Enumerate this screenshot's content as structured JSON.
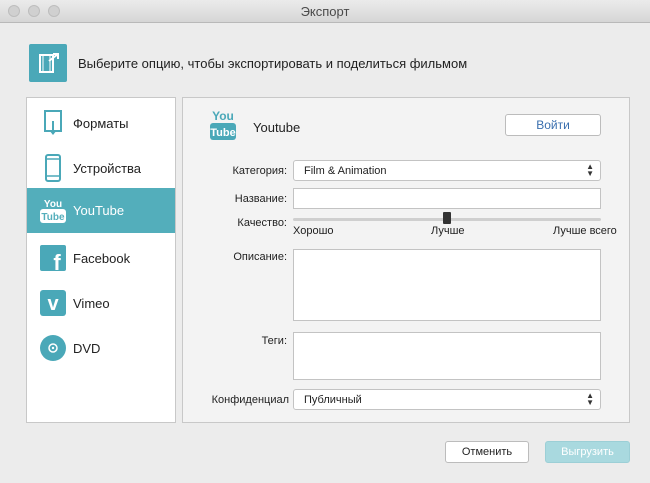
{
  "window": {
    "title": "Экспорт"
  },
  "header": {
    "text": "Выберите опцию, чтобы экспортировать и поделиться фильмом",
    "icon": "film-export-icon"
  },
  "sidebar": {
    "items": [
      {
        "label": "Форматы",
        "icon": "formats-icon",
        "active": false
      },
      {
        "label": "Устройства",
        "icon": "phone-icon",
        "active": false
      },
      {
        "label": "YouTube",
        "icon": "youtube-icon",
        "active": true,
        "icon_text": [
          "You",
          "Tube"
        ]
      },
      {
        "label": "Facebook",
        "icon": "facebook-icon",
        "active": false,
        "icon_text": "f"
      },
      {
        "label": "Vimeo",
        "icon": "vimeo-icon",
        "active": false,
        "icon_text": "v"
      },
      {
        "label": "DVD",
        "icon": "dvd-icon",
        "active": false
      }
    ]
  },
  "panel": {
    "title": "Youtube",
    "icon_text": [
      "You",
      "Tube"
    ],
    "login_label": "Войти",
    "category_label": "Категория:",
    "category_value": "Film & Animation",
    "name_label": "Название:",
    "name_value": "",
    "quality_label": "Качество:",
    "quality_ticks": [
      "Хорошо",
      "Лучше",
      "Лучше всего"
    ],
    "quality_value": 0.5,
    "description_label": "Описание:",
    "description_value": "",
    "tags_label": "Теги:",
    "tags_value": "",
    "privacy_label": "Конфиденциал",
    "privacy_value": "Публичный"
  },
  "footer": {
    "cancel_label": "Отменить",
    "upload_label": "Выгрузить"
  },
  "colors": {
    "accent": "#53aebb",
    "link": "#3a6fae",
    "upload_bg": "#a9d9df"
  }
}
